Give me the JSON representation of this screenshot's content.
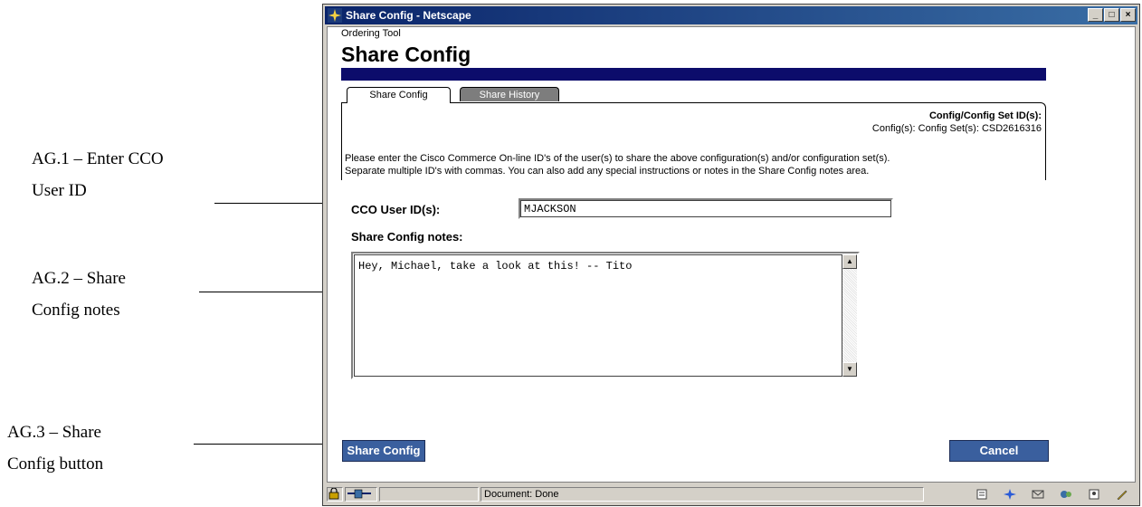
{
  "annotations": {
    "ag1": {
      "line1": "AG.1 – Enter CCO",
      "line2": "User ID"
    },
    "ag2": {
      "line1": "AG.2 – Share",
      "line2": "Config notes"
    },
    "ag3": {
      "line1": "AG.3 – Share",
      "line2": "Config button"
    }
  },
  "window": {
    "title": "Share Config - Netscape"
  },
  "page": {
    "app_name": "Ordering Tool",
    "title": "Share Config",
    "header_color": "#0c0c6b"
  },
  "tabs": [
    {
      "label": "Share Config",
      "active": true
    },
    {
      "label": "Share History",
      "active": false
    }
  ],
  "panel": {
    "heading": "Config/Config Set ID(s):",
    "ids_text": "Config(s): Config Set(s): CSD2616316",
    "instructions_line1": "Please enter the Cisco Commerce On-line ID's of the user(s) to share the above configuration(s) and/or configuration set(s).",
    "instructions_line2": "Separate multiple ID's with commas. You can also add any special instructions or notes in the Share Config notes area."
  },
  "form": {
    "user_id_label": "CCO User ID(s):",
    "user_id_value": "MJACKSON",
    "notes_label": "Share Config notes:",
    "notes_value": "Hey, Michael, take a look at this! -- Tito"
  },
  "buttons": {
    "share": "Share Config",
    "cancel": "Cancel",
    "color": "#3a5f9e"
  },
  "statusbar": {
    "text": "Document: Done"
  }
}
